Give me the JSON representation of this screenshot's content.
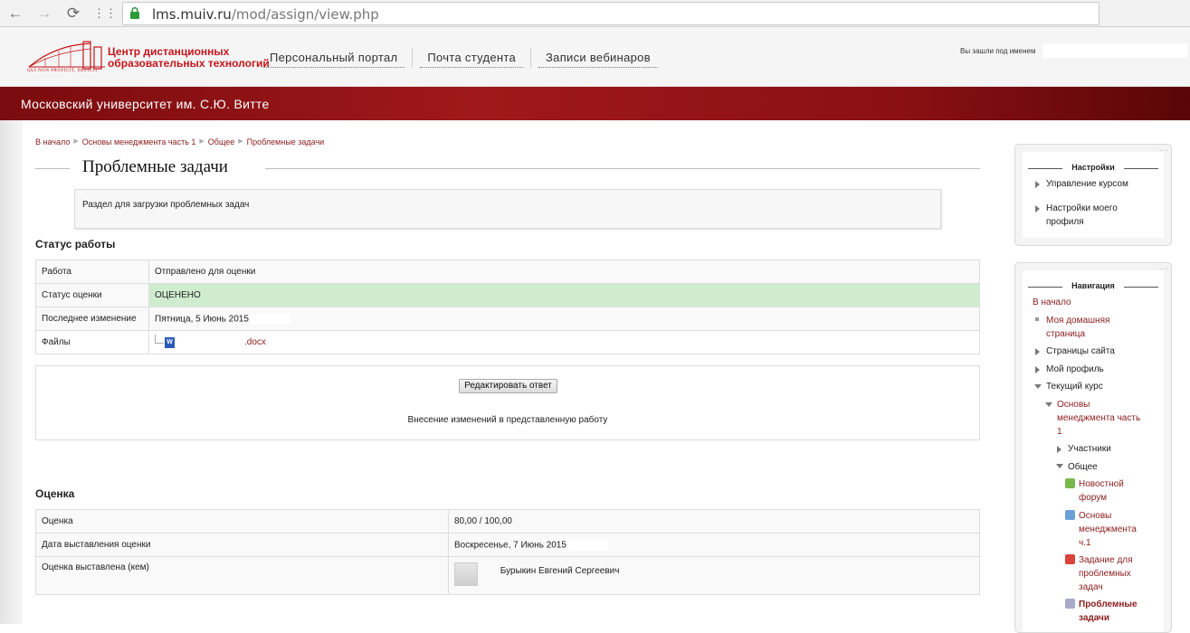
{
  "browser": {
    "url_host": "lms.muiv.ru",
    "url_path": "/mod/assign/view.php"
  },
  "header": {
    "logo_line1": "Центр дистанционных",
    "logo_line2": "образовательных технологий",
    "logo_motto": "QUI NON PROFICIT, DEFICIT",
    "menu": [
      "Персональный портал",
      "Почта студента",
      "Записи вебинаров"
    ],
    "login_label": "Вы зашли под именем"
  },
  "banner": {
    "title": "Московский университет им. С.Ю. Витте"
  },
  "breadcrumb": [
    "В начало",
    "Основы менеджмента часть 1",
    "Общее",
    "Проблемные задачи"
  ],
  "page": {
    "title": "Проблемные задачи",
    "intro": "Раздел для загрузки проблемных задач"
  },
  "status": {
    "heading": "Статус работы",
    "rows": [
      {
        "label": "Работа",
        "value": "Отправлено для оценки"
      },
      {
        "label": "Статус оценки",
        "value": "ОЦЕНЕНО"
      },
      {
        "label": "Последнее изменение",
        "value": "Пятница, 5 Июнь 2015"
      },
      {
        "label": "Файлы",
        "value": ".docx"
      }
    ],
    "edit_button": "Редактировать ответ",
    "edit_note": "Внесение изменений в представленную работу",
    "status_color": "#cfeccf"
  },
  "grade": {
    "heading": "Оценка",
    "rows": [
      {
        "label": "Оценка",
        "value": "80,00 / 100,00"
      },
      {
        "label": "Дата выставления оценки",
        "value": "Воскресенье, 7 Июнь 2015"
      },
      {
        "label": "Оценка выставлена (кем)",
        "value": "Бурыкин Евгений Сергеевич"
      }
    ]
  },
  "settings_block": {
    "title": "Настройки",
    "items": [
      "Управление курсом",
      "Настройки моего",
      "профиля"
    ]
  },
  "nav_block": {
    "title": "Навигация",
    "home": "В начало",
    "my_home": [
      "Моя домашняя",
      "страница"
    ],
    "site_pages": "Страницы сайта",
    "my_profile": "Мой профиль",
    "current_course": "Текущий курс",
    "course": [
      "Основы",
      "менеджмента часть",
      "1"
    ],
    "participants": "Участники",
    "general": "Общее",
    "forum": [
      "Новостной",
      "форум"
    ],
    "resource": [
      "Основы",
      "менеджмента",
      "ч.1"
    ],
    "assignment": [
      "Задание для",
      "проблемных",
      "задач"
    ],
    "current": [
      "Проблемные",
      "задачи"
    ]
  },
  "colors": {
    "brand": "#8b1c1c",
    "banner": "#a0181b"
  }
}
